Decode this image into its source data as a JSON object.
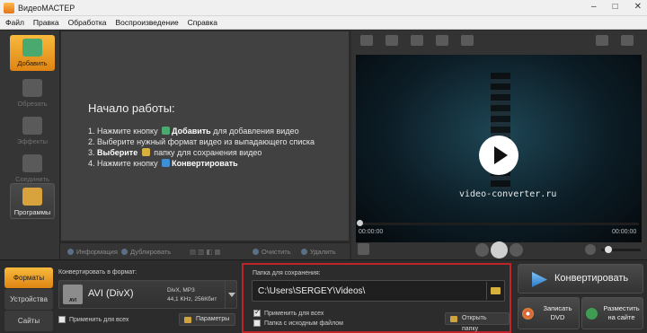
{
  "window": {
    "title": "ВидеоМАСТЕР",
    "controls": [
      "–",
      "□",
      "✕"
    ]
  },
  "menu": [
    "Файл",
    "Правка",
    "Обработка",
    "Воспроизведение",
    "Справка"
  ],
  "toolbar": {
    "items": [
      {
        "label": "Добавить",
        "icon": "add-video-icon",
        "state": "active"
      },
      {
        "label": "Обрезать",
        "icon": "trim-icon",
        "state": "disabled"
      },
      {
        "label": "Эффекты",
        "icon": "effects-icon",
        "state": "disabled"
      },
      {
        "label": "Соединить",
        "icon": "join-icon",
        "state": "disabled"
      },
      {
        "label": "Программы",
        "icon": "programs-icon",
        "state": "normal"
      }
    ]
  },
  "start": {
    "heading": "Начало работы:",
    "step1_pre": "1. Нажмите кнопку",
    "step1_bold": "Добавить",
    "step1_post": "для добавления видео",
    "step2": "2. Выберите нужный формат видео из выпадающего списка",
    "step3_pre": "3.",
    "step3_bold": "Выберите",
    "step3_post": "папку для сохранения видео",
    "step4_pre": "4. Нажмите кнопку",
    "step4_bold": "Конвертировать"
  },
  "actions": {
    "info": "Информация",
    "duplicate": "Дублировать",
    "clear": "Очистить",
    "delete": "Удалить"
  },
  "preview": {
    "brand": "video-converter.ru",
    "time_current": "00:00:00",
    "time_total": "00:00:00",
    "volume_level": 0.25
  },
  "bottom_tabs": [
    "Форматы",
    "Устройства",
    "Сайты"
  ],
  "format": {
    "label": "Конвертировать в формат:",
    "badge": "AVI",
    "name": "AVI (DivX)",
    "spec_line1": "DivX, MP3",
    "spec_line2": "44,1 KHz, 256Кбит",
    "apply_all": "Применить для всех",
    "params_button": "Параметры"
  },
  "save": {
    "label": "Папка для сохранения:",
    "path": "C:\\Users\\SERGEY\\Videos\\",
    "apply_all": "Применить для всех",
    "apply_all_checked": true,
    "source_folder": "Папка с исходным файлом",
    "source_folder_checked": false,
    "open_folder": "Открыть папку"
  },
  "buttons": {
    "convert": "Конвертировать",
    "burn_dvd": "Записать DVD",
    "publish_web": "Разместить на сайте"
  },
  "colors": {
    "accent_orange": "#f0a02a",
    "highlight_red": "#c0242b",
    "panel_dark": "#2c2c2c"
  }
}
